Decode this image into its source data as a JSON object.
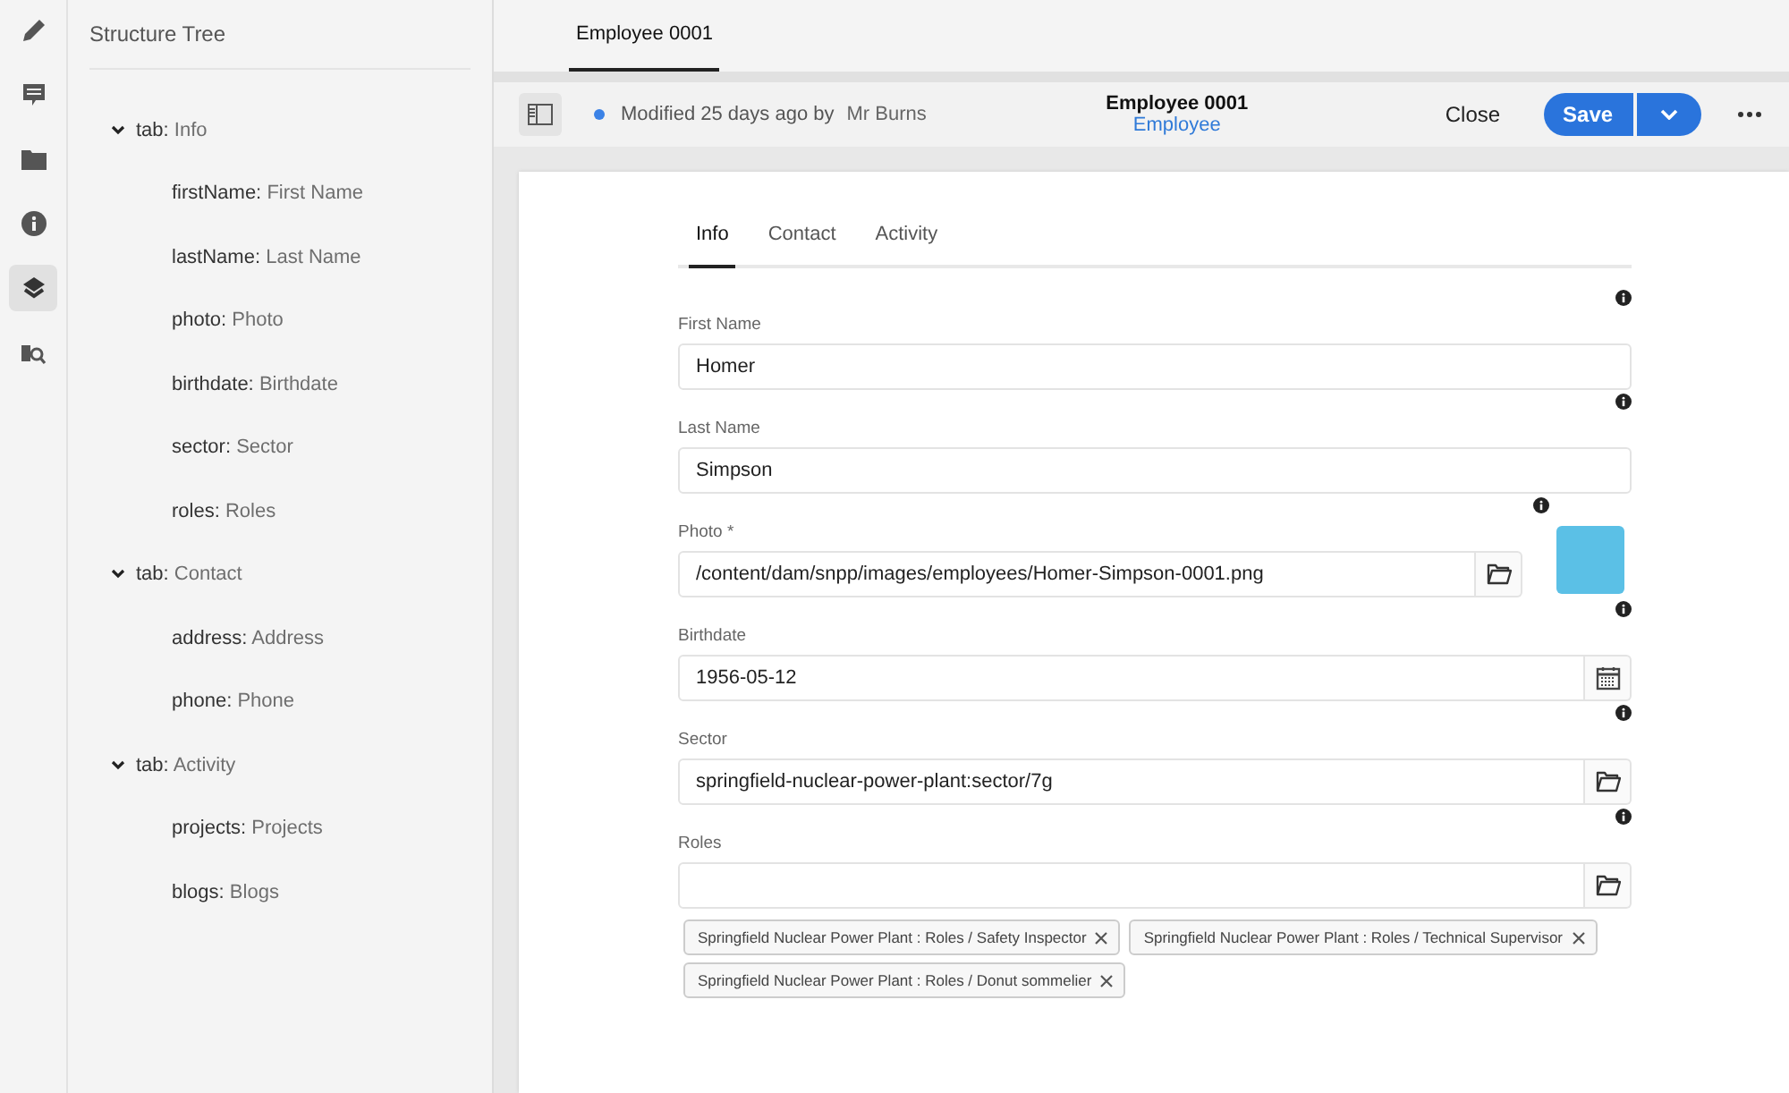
{
  "rail": [
    {
      "kind": "pencil",
      "selected": false
    },
    {
      "kind": "comment",
      "selected": false
    },
    {
      "kind": "folder",
      "selected": false
    },
    {
      "kind": "info",
      "selected": false
    },
    {
      "kind": "layers",
      "selected": true
    },
    {
      "kind": "search",
      "selected": false
    }
  ],
  "tree": {
    "title": "Structure Tree",
    "nodes": [
      {
        "key": "tab:",
        "label": "Info",
        "expanded": true,
        "children": [
          {
            "key": "firstName:",
            "label": "First Name"
          },
          {
            "key": "lastName:",
            "label": "Last Name"
          },
          {
            "key": "photo:",
            "label": "Photo"
          },
          {
            "key": "birthdate:",
            "label": "Birthdate"
          },
          {
            "key": "sector:",
            "label": "Sector"
          },
          {
            "key": "roles:",
            "label": "Roles"
          }
        ]
      },
      {
        "key": "tab:",
        "label": "Contact",
        "expanded": true,
        "children": [
          {
            "key": "address:",
            "label": "Address"
          },
          {
            "key": "phone:",
            "label": "Phone"
          }
        ]
      },
      {
        "key": "tab:",
        "label": "Activity",
        "expanded": true,
        "children": [
          {
            "key": "projects:",
            "label": "Projects"
          },
          {
            "key": "blogs:",
            "label": "Blogs"
          }
        ]
      }
    ]
  },
  "doc_tabs": [
    {
      "label": "Employee 0001",
      "selected": true
    }
  ],
  "toolbar": {
    "status": "Modified 25 days ago by",
    "user": "Mr Burns",
    "title": "Employee 0001",
    "subtitle": "Employee",
    "close": "Close",
    "save": "Save"
  },
  "form_tabs": [
    {
      "label": "Info",
      "selected": true
    },
    {
      "label": "Contact",
      "selected": false
    },
    {
      "label": "Activity",
      "selected": false
    }
  ],
  "fields": [
    {
      "kind": "text",
      "label": "First Name",
      "value": "Homer"
    },
    {
      "kind": "text",
      "label": "Last Name",
      "value": "Simpson"
    },
    {
      "kind": "photo",
      "label": "Photo *",
      "value": "/content/dam/snpp/images/employees/Homer-Simpson-0001.png"
    },
    {
      "kind": "date",
      "label": "Birthdate",
      "value": "1956-05-12"
    },
    {
      "kind": "path",
      "label": "Sector",
      "value": "springfield-nuclear-power-plant:sector/7g"
    },
    {
      "kind": "tags",
      "label": "Roles",
      "tags": [
        "Springfield Nuclear Power Plant : Roles / Safety Inspector",
        "Springfield Nuclear Power Plant : Roles / Technical Supervisor",
        "Springfield Nuclear Power Plant : Roles / Donut sommelier"
      ]
    }
  ]
}
